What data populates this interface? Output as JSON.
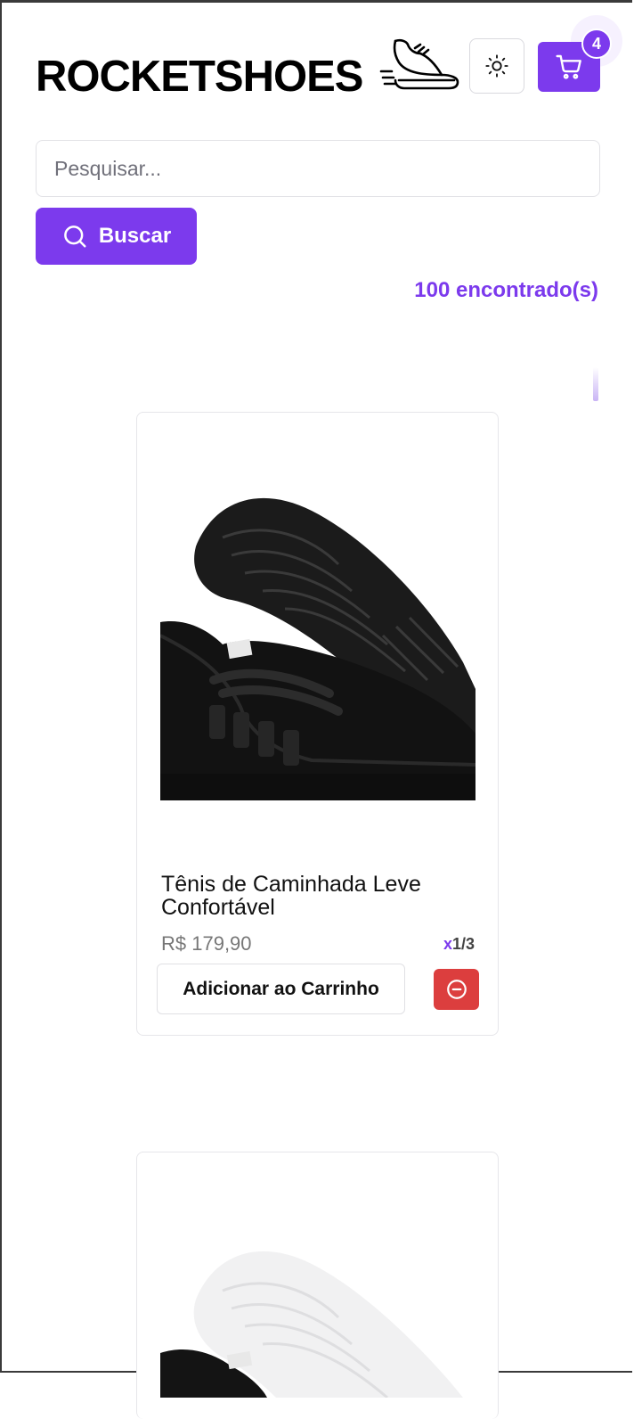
{
  "header": {
    "logo_text": "ROCKETSHOES",
    "logo_icon": "running-shoe-icon",
    "theme_toggle_icon": "sun-icon",
    "cart_icon": "shopping-cart-icon",
    "cart_count": "4"
  },
  "search": {
    "placeholder": "Pesquisar...",
    "value": "",
    "button_label": "Buscar",
    "button_icon": "search-icon"
  },
  "results": {
    "count_text": "100 encontrado(s)"
  },
  "products": [
    {
      "title": "Tênis de Caminhada Leve Confortável",
      "price": "R$ 179,90",
      "qty_prefix": "x",
      "qty_value": "1/3",
      "add_label": "Adicionar ao Carrinho",
      "remove_icon": "minus-circle-icon",
      "image_colorway": "black"
    },
    {
      "image_colorway": "white-sole"
    }
  ],
  "colors": {
    "accent": "#7c3aed",
    "danger": "#dc3e3e",
    "text": "#111111",
    "muted": "#777777"
  }
}
